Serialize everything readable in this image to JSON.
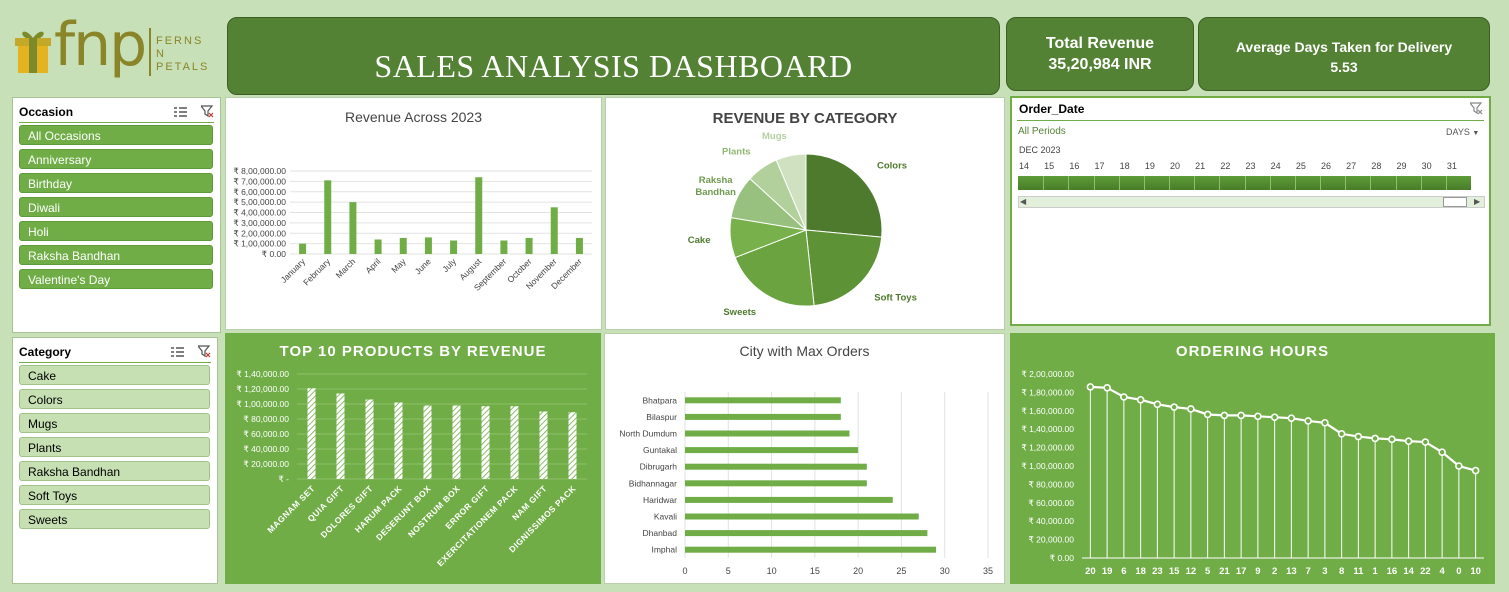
{
  "logo": {
    "mark": "fnp",
    "words": [
      "FERNS",
      "N",
      "PETALS"
    ]
  },
  "title": "SALES ANALYSIS DASHBOARD",
  "kpis": {
    "revenue": {
      "label": "Total Revenue",
      "value": "35,20,984 INR"
    },
    "delivery": {
      "label": "Average Days Taken for Delivery",
      "value": "5.53"
    }
  },
  "colors": {
    "dark_green": "#548235",
    "green": "#70ad47",
    "light_green": "#c6e0b4",
    "background": "#c8e0b8"
  },
  "occasion_slicer": {
    "title": "Occasion",
    "items": [
      "All Occasions",
      "Anniversary",
      "Birthday",
      "Diwali",
      "Holi",
      "Raksha Bandhan",
      "Valentine's Day"
    ]
  },
  "category_slicer": {
    "title": "Category",
    "items": [
      "Cake",
      "Colors",
      "Mugs",
      "Plants",
      "Raksha Bandhan",
      "Soft Toys",
      "Sweets"
    ]
  },
  "timeline": {
    "title": "Order_Date",
    "period": "All Periods",
    "level": "DAYS",
    "month": "DEC 2023",
    "days": [
      "14",
      "15",
      "16",
      "17",
      "18",
      "19",
      "20",
      "21",
      "22",
      "23",
      "24",
      "25",
      "26",
      "27",
      "28",
      "29",
      "30",
      "31"
    ]
  },
  "chart_data": [
    {
      "type": "bar",
      "title": "Revenue Across 2023",
      "categories": [
        "January",
        "February",
        "March",
        "April",
        "May",
        "June",
        "July",
        "August",
        "September",
        "October",
        "November",
        "December"
      ],
      "values": [
        100000,
        710000,
        500000,
        140000,
        155000,
        160000,
        130000,
        740000,
        130000,
        155000,
        450000,
        155000
      ],
      "ylim": [
        0,
        800000
      ],
      "yticks": [
        "₹ 0.00",
        "₹ 1,00,000.00",
        "₹ 2,00,000.00",
        "₹ 3,00,000.00",
        "₹ 4,00,000.00",
        "₹ 5,00,000.00",
        "₹ 6,00,000.00",
        "₹ 7,00,000.00",
        "₹ 8,00,000.00"
      ],
      "grid": true
    },
    {
      "type": "pie",
      "title": "REVENUE BY CATEGORY",
      "categories": [
        "Colors",
        "Soft Toys",
        "Sweets",
        "Cake",
        "Raksha Bandhan",
        "Plants",
        "Mugs"
      ],
      "values": [
        26.5,
        21.8,
        20.8,
        8.5,
        9.2,
        6.8,
        6.4
      ],
      "colors": [
        "#4e7a2e",
        "#5d9236",
        "#6aa340",
        "#78b04c",
        "#98c07e",
        "#b2d09c",
        "#cfe1c0"
      ]
    },
    {
      "type": "bar",
      "title": "TOP 10 PRODUCTS BY REVENUE",
      "categories": [
        "MAGNAM SET",
        "QUIA GIFT",
        "DOLORES GIFT",
        "HARUM PACK",
        "DESERUNT BOX",
        "NOSTRUM BOX",
        "ERROR GIFT",
        "EXERCITATIONEM PACK",
        "NAM GIFT",
        "DIGNISSIMOS PACK"
      ],
      "values": [
        121000,
        114000,
        106000,
        102000,
        98000,
        98000,
        97000,
        97000,
        90000,
        89000
      ],
      "ylim": [
        0,
        140000
      ],
      "yticks": [
        "₹ -",
        "₹ 20,000.00",
        "₹ 40,000.00",
        "₹ 60,000.00",
        "₹ 80,000.00",
        "₹ 1,00,000.00",
        "₹ 1,20,000.00",
        "₹ 1,40,000.00"
      ],
      "grid": true
    },
    {
      "type": "bar",
      "orientation": "horizontal",
      "title": "City with Max Orders",
      "categories": [
        "Bhatpara",
        "Bilaspur",
        "North Dumdum",
        "Guntakal",
        "Dibrugarh",
        "Bidhannagar",
        "Haridwar",
        "Kavali",
        "Dhanbad",
        "Imphal"
      ],
      "values": [
        18,
        18,
        19,
        20,
        21,
        21,
        24,
        27,
        28,
        29
      ],
      "xlim": [
        0,
        35
      ],
      "xticks": [
        "0",
        "5",
        "10",
        "15",
        "20",
        "25",
        "30",
        "35"
      ],
      "grid": true
    },
    {
      "type": "line",
      "title": "ORDERING HOURS",
      "categories": [
        "20",
        "19",
        "6",
        "18",
        "23",
        "15",
        "12",
        "5",
        "21",
        "17",
        "9",
        "2",
        "13",
        "7",
        "3",
        "8",
        "11",
        "1",
        "16",
        "14",
        "22",
        "4",
        "0",
        "10"
      ],
      "values": [
        186000,
        185000,
        175000,
        172000,
        167000,
        164000,
        162000,
        156000,
        155000,
        155000,
        154000,
        153000,
        152000,
        149000,
        147000,
        135000,
        132000,
        130000,
        129000,
        127000,
        126000,
        115000,
        100000,
        95000
      ],
      "ylim": [
        0,
        200000
      ],
      "yticks": [
        "₹ 0.00",
        "₹ 20,000.00",
        "₹ 40,000.00",
        "₹ 60,000.00",
        "₹ 80,000.00",
        "₹ 1,00,000.00",
        "₹ 1,20,000.00",
        "₹ 1,40,000.00",
        "₹ 1,60,000.00",
        "₹ 1,80,000.00",
        "₹ 2,00,000.00"
      ],
      "markers": true,
      "drop_lines": true
    }
  ]
}
